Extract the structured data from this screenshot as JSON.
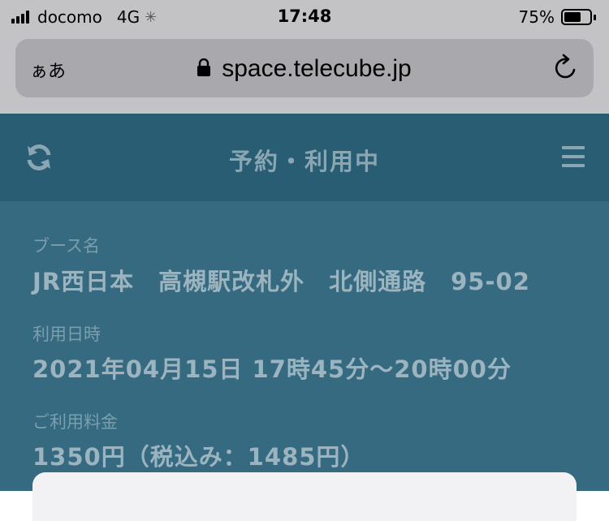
{
  "status_bar": {
    "carrier": "docomo",
    "network": "4G",
    "time": "17:48",
    "battery_percent": "75%",
    "battery_level": 0.75
  },
  "browser": {
    "aa_label": "ぁあ",
    "url": "space.telecube.jp"
  },
  "header": {
    "title": "予約・利用中"
  },
  "details": {
    "booth_label": "ブース名",
    "booth_value": "JR西日本　高槻駅改札外　北側通路　95-02",
    "datetime_label": "利用日時",
    "datetime_value": "2021年04月15日 17時45分～20時00分",
    "fee_label": "ご利用料金",
    "fee_value": "1350円（税込み：1485円）"
  },
  "colors": {
    "header_bg": "#285d73",
    "content_bg": "#356a80",
    "browser_chrome": "#c3c3c6"
  }
}
